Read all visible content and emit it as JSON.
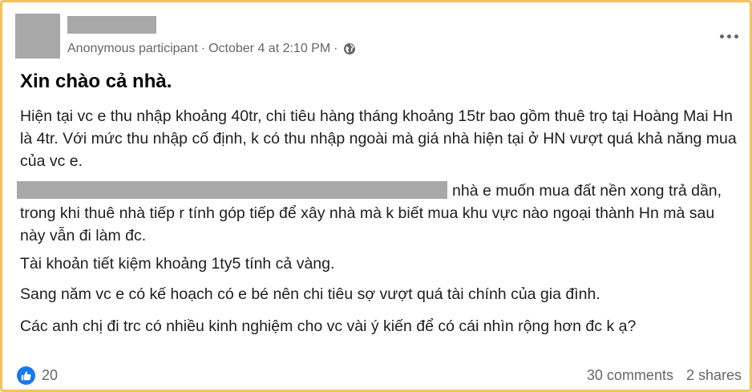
{
  "post": {
    "author_meta": "Anonymous participant",
    "separator": "·",
    "timestamp": "October 4 at 2:10 PM",
    "title": "Xin chào cả nhà.",
    "paragraphs": [
      "Hiện tại vc e thu nhập khoảng 40tr, chi tiêu hàng tháng khoảng 15tr bao gồm thuê trọ tại Hoàng Mai Hn là 4tr. Với mức thu nhập cố định, k có thu nhập ngoài mà giá nhà hiện tại ở HN vượt quá khả năng mua của vc e.",
      "nhà e muốn mua đất nền xong trả dần, trong khi thuê nhà tiếp r tính góp tiếp để xây nhà mà k biết mua khu vực nào ngoại thành Hn mà sau này vẫn đi làm đc.",
      "Tài khoản tiết kiệm khoảng 1ty5 tính cả vàng.",
      "Sang năm vc e có kế hoạch có e bé nên chi tiêu sợ vượt quá tài chính của gia đình.",
      "Các anh chị đi trc có nhiều kinh nghiệm cho vc vài ý kiến để có cái nhìn rộng hơn đc k ạ?"
    ]
  },
  "footer": {
    "like_count": "20",
    "comments": "30 comments",
    "shares": "2 shares"
  },
  "icons": {
    "privacy": "globe-icon",
    "more": "more-options-icon",
    "reaction": "like-icon"
  },
  "colors": {
    "border": "#f3c25c",
    "like": "#1877f2",
    "meta_text": "#65676b"
  }
}
